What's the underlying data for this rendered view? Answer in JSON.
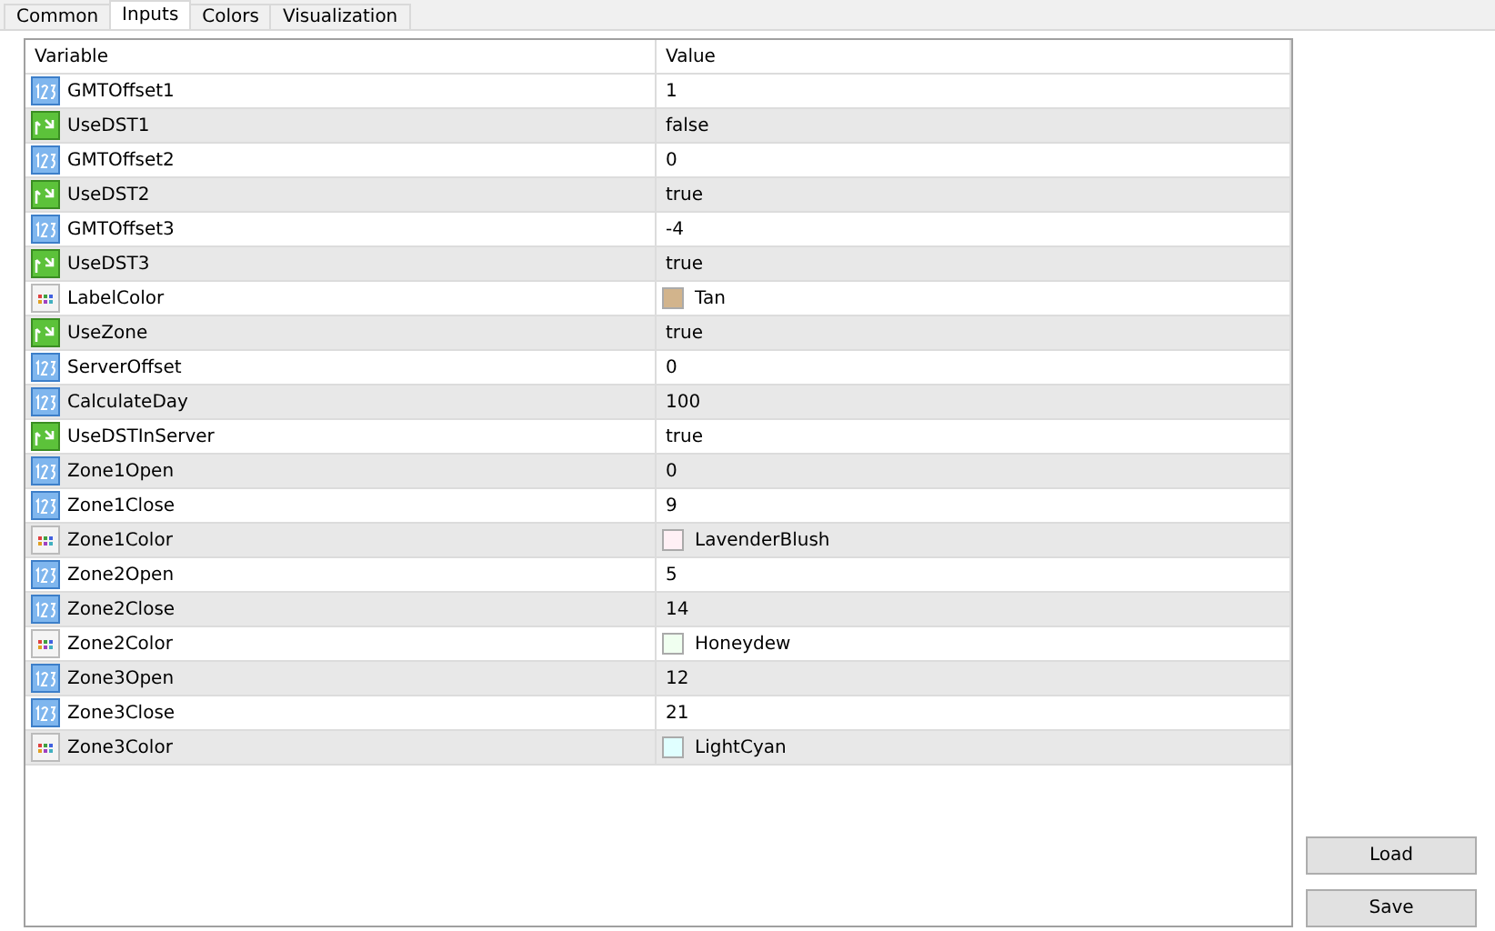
{
  "tabs": [
    {
      "label": "Common",
      "selected": false
    },
    {
      "label": "Inputs",
      "selected": true
    },
    {
      "label": "Colors",
      "selected": false
    },
    {
      "label": "Visualization",
      "selected": false
    }
  ],
  "table": {
    "columns": [
      "Variable",
      "Value"
    ],
    "rows": [
      {
        "kind": "int",
        "name": "GMTOffset1",
        "value": "1"
      },
      {
        "kind": "bool",
        "name": "UseDST1",
        "value": "false"
      },
      {
        "kind": "int",
        "name": "GMTOffset2",
        "value": "0"
      },
      {
        "kind": "bool",
        "name": "UseDST2",
        "value": "true"
      },
      {
        "kind": "int",
        "name": "GMTOffset3",
        "value": "-4"
      },
      {
        "kind": "bool",
        "name": "UseDST3",
        "value": "true"
      },
      {
        "kind": "color",
        "name": "LabelColor",
        "value": "Tan",
        "color": "#d2b48c"
      },
      {
        "kind": "bool",
        "name": "UseZone",
        "value": "true"
      },
      {
        "kind": "int",
        "name": "ServerOffset",
        "value": "0"
      },
      {
        "kind": "int",
        "name": "CalculateDay",
        "value": "100"
      },
      {
        "kind": "bool",
        "name": "UseDSTInServer",
        "value": "true"
      },
      {
        "kind": "int",
        "name": "Zone1Open",
        "value": "0"
      },
      {
        "kind": "int",
        "name": "Zone1Close",
        "value": "9"
      },
      {
        "kind": "color",
        "name": "Zone1Color",
        "value": "LavenderBlush",
        "color": "#fff0f5"
      },
      {
        "kind": "int",
        "name": "Zone2Open",
        "value": "5"
      },
      {
        "kind": "int",
        "name": "Zone2Close",
        "value": "14"
      },
      {
        "kind": "color",
        "name": "Zone2Color",
        "value": "Honeydew",
        "color": "#f0fff0"
      },
      {
        "kind": "int",
        "name": "Zone3Open",
        "value": "12"
      },
      {
        "kind": "int",
        "name": "Zone3Close",
        "value": "21"
      },
      {
        "kind": "color",
        "name": "Zone3Color",
        "value": "LightCyan",
        "color": "#e0ffff"
      }
    ]
  },
  "buttons": [
    "Load",
    "Save"
  ]
}
